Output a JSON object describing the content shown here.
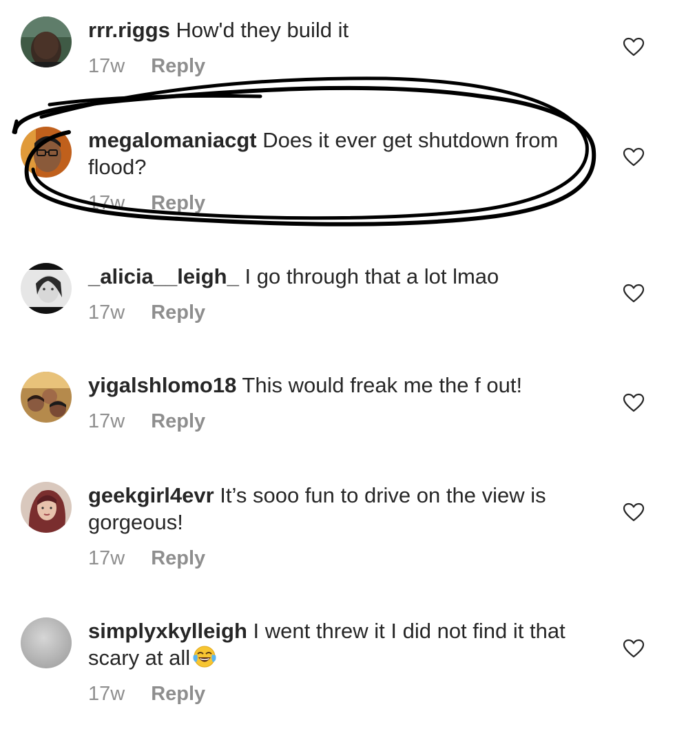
{
  "comments": [
    {
      "username": "rrr.riggs",
      "text": "How'd they build it",
      "time": "17w",
      "reply": "Reply",
      "avatar": "avatar-photo-man-outdoors"
    },
    {
      "username": "megalomaniacgt",
      "text": "Does it ever get shutdown from flood?",
      "time": "17w",
      "reply": "Reply",
      "avatar": "avatar-photo-man-glasses"
    },
    {
      "username": "_alicia__leigh_",
      "text": "I go through that a lot lmao",
      "time": "17w",
      "reply": "Reply",
      "avatar": "avatar-photo-woman-bw"
    },
    {
      "username": "yigalshlomo18",
      "text": "This would freak me the f out!",
      "time": "17w",
      "reply": "Reply",
      "avatar": "avatar-photo-group"
    },
    {
      "username": "geekgirl4evr",
      "text": "It’s sooo fun to drive on the view is gorgeous!",
      "time": "17w",
      "reply": "Reply",
      "avatar": "avatar-photo-woman-red-hair"
    },
    {
      "username": "simplyxkylleigh",
      "text": "I went threw it I did not find it that scary at all",
      "time": "17w",
      "reply": "Reply",
      "avatar": "avatar-default-gray",
      "emoji": "face-with-tears-of-joy"
    }
  ],
  "colors": {
    "text": "#262626",
    "secondary": "#8e8e8e",
    "background": "#ffffff",
    "scribble": "#000000"
  },
  "icons": {
    "like": "heart-outline-icon"
  }
}
